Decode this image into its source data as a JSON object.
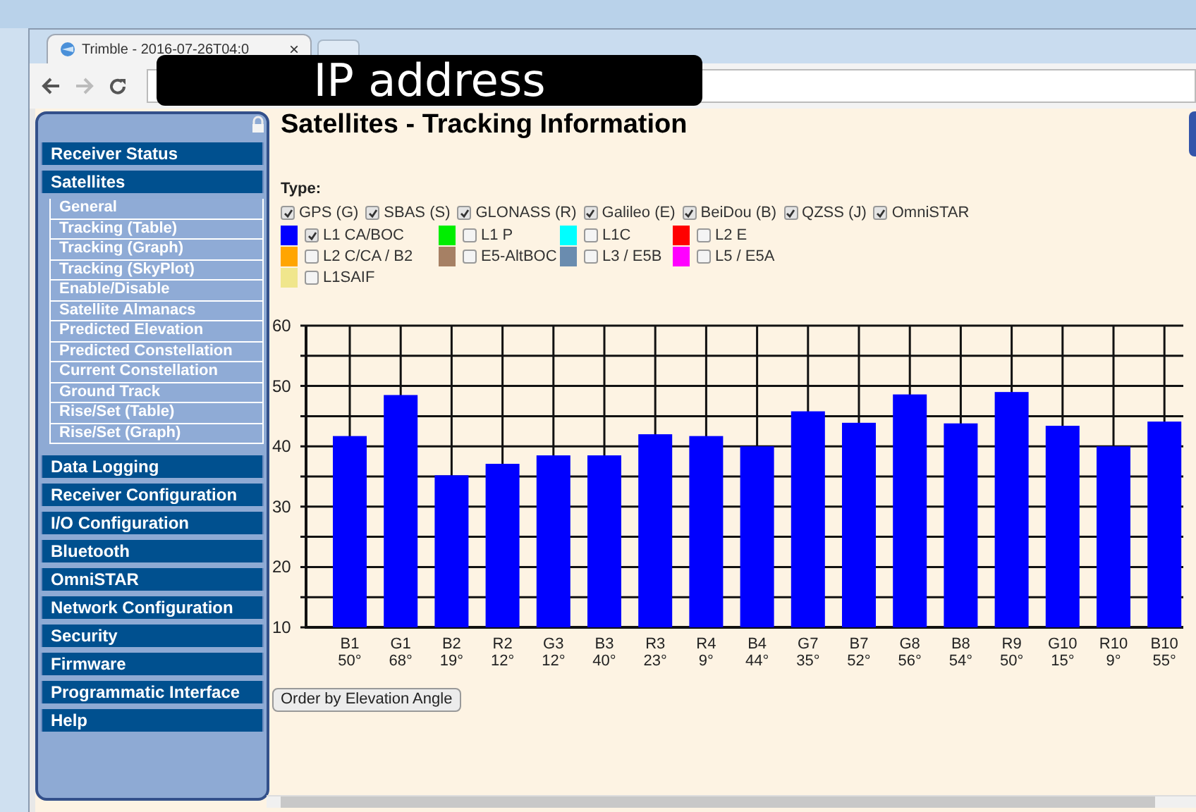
{
  "browser": {
    "tab_title": "Trimble - 2016-07-26T04:0",
    "address_overlay": "IP address",
    "tab_close": "×"
  },
  "sidebar": {
    "items": [
      {
        "label": "Receiver Status"
      },
      {
        "label": "Satellites",
        "children": [
          {
            "label": "General"
          },
          {
            "label": "Tracking (Table)"
          },
          {
            "label": "Tracking (Graph)"
          },
          {
            "label": "Tracking (SkyPlot)"
          },
          {
            "label": "Enable/Disable"
          },
          {
            "label": "Satellite Almanacs"
          },
          {
            "label": "Predicted Elevation"
          },
          {
            "label": "Predicted Constellation"
          },
          {
            "label": "Current Constellation"
          },
          {
            "label": "Ground Track"
          },
          {
            "label": "Rise/Set (Table)"
          },
          {
            "label": "Rise/Set (Graph)"
          }
        ]
      },
      {
        "label": "Data Logging"
      },
      {
        "label": "Receiver Configuration"
      },
      {
        "label": "I/O Configuration"
      },
      {
        "label": "Bluetooth"
      },
      {
        "label": "OmniSTAR"
      },
      {
        "label": "Network Configuration"
      },
      {
        "label": "Security"
      },
      {
        "label": "Firmware"
      },
      {
        "label": "Programmatic Interface"
      },
      {
        "label": "Help"
      }
    ]
  },
  "page": {
    "title": "Satellites - Tracking Information",
    "type_label": "Type:",
    "systems": [
      {
        "label": "GPS (G)",
        "checked": true
      },
      {
        "label": "SBAS (S)",
        "checked": true
      },
      {
        "label": "GLONASS (R)",
        "checked": true
      },
      {
        "label": "Galileo (E)",
        "checked": true
      },
      {
        "label": "BeiDou (B)",
        "checked": true
      },
      {
        "label": "QZSS (J)",
        "checked": true
      },
      {
        "label": "OmniSTAR",
        "checked": true
      }
    ],
    "signals": [
      {
        "label": "L1 CA/BOC",
        "color": "#0000ff",
        "checked": true
      },
      {
        "label": "L1 P",
        "color": "#00ee00",
        "checked": false
      },
      {
        "label": "L1C",
        "color": "#00ffff",
        "checked": false
      },
      {
        "label": "L2 E",
        "color": "#ff0000",
        "checked": false
      },
      {
        "label": "L2 C/CA / B2",
        "color": "#ffa500",
        "checked": false
      },
      {
        "label": "E5-AltBOC",
        "color": "#a68064",
        "checked": false
      },
      {
        "label": "L3 / E5B",
        "color": "#6a8caf",
        "checked": false
      },
      {
        "label": "L5 / E5A",
        "color": "#ff00ff",
        "checked": false
      },
      {
        "label": "L1SAIF",
        "color": "#f0e68c",
        "checked": false
      }
    ],
    "chart": {
      "elevations": [
        "50°",
        "68°",
        "19°",
        "12°",
        "12°",
        "40°",
        "23°",
        "9°",
        "44°",
        "35°",
        "52°",
        "56°",
        "54°",
        "50°",
        "15°",
        "9°",
        "55°"
      ],
      "chart_data": {
        "type": "bar",
        "categories": [
          "B1",
          "G1",
          "B2",
          "R2",
          "G3",
          "B3",
          "R3",
          "R4",
          "B4",
          "G7",
          "B7",
          "G8",
          "B8",
          "R9",
          "G10",
          "R10",
          "B10"
        ],
        "series": [
          {
            "color": "#0000ff",
            "values": [
              41.7,
              48.5,
              35.2,
              37.1,
              38.5,
              38.5,
              42,
              41.7,
              40,
              45.8,
              43.9,
              48.6,
              43.8,
              49,
              43.4,
              40,
              44.1
            ]
          }
        ],
        "grid": true,
        "ylim": [
          10,
          60
        ],
        "yticks": [
          10,
          20,
          30,
          40,
          50,
          60
        ]
      }
    },
    "order_button": "Order by Elevation Angle"
  }
}
